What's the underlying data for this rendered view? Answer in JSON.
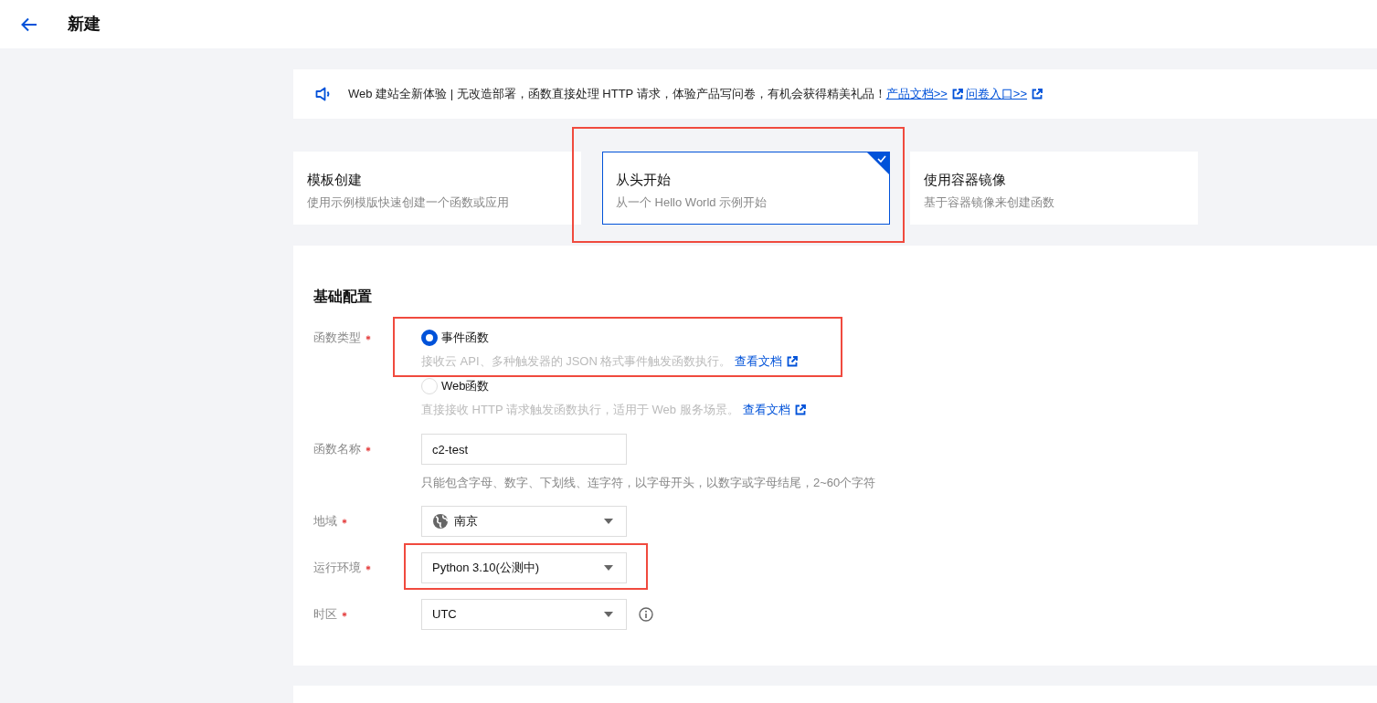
{
  "header": {
    "title": "新建"
  },
  "notice": {
    "text": "Web 建站全新体验 | 无改造部署，函数直接处理 HTTP 请求，体验产品写问卷，有机会获得精美礼品！",
    "links": [
      "产品文档>>",
      "问卷入口>>"
    ]
  },
  "creation_modes": [
    {
      "title": "模板创建",
      "description": "使用示例模版快速创建一个函数或应用",
      "selected": false,
      "highlighted": false
    },
    {
      "title": "从头开始",
      "description": "从一个 Hello World 示例开始",
      "selected": true,
      "highlighted": true
    },
    {
      "title": "使用容器镜像",
      "description": "基于容器镜像来创建函数",
      "selected": false,
      "highlighted": false
    }
  ],
  "section": {
    "title": "基础配置"
  },
  "form": [
    {
      "kind": "radio",
      "label": "函数类型",
      "required": true,
      "options": [
        {
          "label": "事件函数",
          "selected": true,
          "highlighted": true,
          "hint": "接收云 API、多种触发器的 JSON 格式事件触发函数执行。",
          "link": "查看文档"
        },
        {
          "label": "Web函数",
          "selected": false,
          "highlighted": false,
          "hint": "直接接收 HTTP 请求触发函数执行，适用于 Web 服务场景。",
          "link": "查看文档"
        }
      ]
    },
    {
      "kind": "input",
      "label": "函数名称",
      "required": true,
      "value": "c2-test",
      "hint": "只能包含字母、数字、下划线、连字符，以字母开头，以数字或字母结尾，2~60个字符",
      "highlighted": false
    },
    {
      "kind": "select",
      "label": "地域",
      "required": true,
      "value": "南京",
      "globe": true,
      "highlighted": false
    },
    {
      "kind": "select",
      "label": "运行环境",
      "required": true,
      "value": "Python 3.10(公测中)",
      "highlighted": true
    },
    {
      "kind": "select",
      "label": "时区",
      "required": true,
      "value": "UTC",
      "info": true,
      "highlighted": false
    }
  ]
}
